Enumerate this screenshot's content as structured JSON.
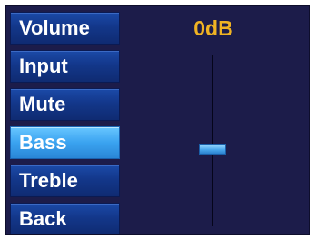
{
  "menu": {
    "items": [
      {
        "label": "Volume"
      },
      {
        "label": "Input"
      },
      {
        "label": "Mute"
      },
      {
        "label": "Bass",
        "selected": true
      },
      {
        "label": "Treble"
      },
      {
        "label": "Back"
      }
    ]
  },
  "control": {
    "value_label": "0dB",
    "slider_level": 0.45,
    "value_color": "#f0b323"
  },
  "colors": {
    "background": "#1c1c4a",
    "button": "#13378a",
    "button_selected": "#3aa3f0"
  }
}
